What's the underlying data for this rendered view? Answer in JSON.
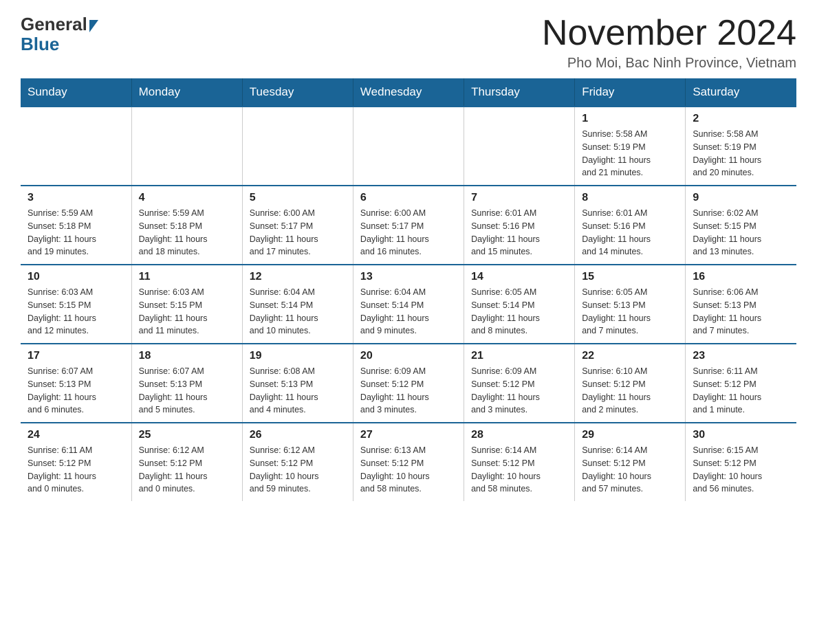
{
  "logo": {
    "general": "General",
    "blue": "Blue"
  },
  "title": "November 2024",
  "subtitle": "Pho Moi, Bac Ninh Province, Vietnam",
  "weekdays": [
    "Sunday",
    "Monday",
    "Tuesday",
    "Wednesday",
    "Thursday",
    "Friday",
    "Saturday"
  ],
  "rows": [
    [
      {
        "day": "",
        "info": ""
      },
      {
        "day": "",
        "info": ""
      },
      {
        "day": "",
        "info": ""
      },
      {
        "day": "",
        "info": ""
      },
      {
        "day": "",
        "info": ""
      },
      {
        "day": "1",
        "info": "Sunrise: 5:58 AM\nSunset: 5:19 PM\nDaylight: 11 hours\nand 21 minutes."
      },
      {
        "day": "2",
        "info": "Sunrise: 5:58 AM\nSunset: 5:19 PM\nDaylight: 11 hours\nand 20 minutes."
      }
    ],
    [
      {
        "day": "3",
        "info": "Sunrise: 5:59 AM\nSunset: 5:18 PM\nDaylight: 11 hours\nand 19 minutes."
      },
      {
        "day": "4",
        "info": "Sunrise: 5:59 AM\nSunset: 5:18 PM\nDaylight: 11 hours\nand 18 minutes."
      },
      {
        "day": "5",
        "info": "Sunrise: 6:00 AM\nSunset: 5:17 PM\nDaylight: 11 hours\nand 17 minutes."
      },
      {
        "day": "6",
        "info": "Sunrise: 6:00 AM\nSunset: 5:17 PM\nDaylight: 11 hours\nand 16 minutes."
      },
      {
        "day": "7",
        "info": "Sunrise: 6:01 AM\nSunset: 5:16 PM\nDaylight: 11 hours\nand 15 minutes."
      },
      {
        "day": "8",
        "info": "Sunrise: 6:01 AM\nSunset: 5:16 PM\nDaylight: 11 hours\nand 14 minutes."
      },
      {
        "day": "9",
        "info": "Sunrise: 6:02 AM\nSunset: 5:15 PM\nDaylight: 11 hours\nand 13 minutes."
      }
    ],
    [
      {
        "day": "10",
        "info": "Sunrise: 6:03 AM\nSunset: 5:15 PM\nDaylight: 11 hours\nand 12 minutes."
      },
      {
        "day": "11",
        "info": "Sunrise: 6:03 AM\nSunset: 5:15 PM\nDaylight: 11 hours\nand 11 minutes."
      },
      {
        "day": "12",
        "info": "Sunrise: 6:04 AM\nSunset: 5:14 PM\nDaylight: 11 hours\nand 10 minutes."
      },
      {
        "day": "13",
        "info": "Sunrise: 6:04 AM\nSunset: 5:14 PM\nDaylight: 11 hours\nand 9 minutes."
      },
      {
        "day": "14",
        "info": "Sunrise: 6:05 AM\nSunset: 5:14 PM\nDaylight: 11 hours\nand 8 minutes."
      },
      {
        "day": "15",
        "info": "Sunrise: 6:05 AM\nSunset: 5:13 PM\nDaylight: 11 hours\nand 7 minutes."
      },
      {
        "day": "16",
        "info": "Sunrise: 6:06 AM\nSunset: 5:13 PM\nDaylight: 11 hours\nand 7 minutes."
      }
    ],
    [
      {
        "day": "17",
        "info": "Sunrise: 6:07 AM\nSunset: 5:13 PM\nDaylight: 11 hours\nand 6 minutes."
      },
      {
        "day": "18",
        "info": "Sunrise: 6:07 AM\nSunset: 5:13 PM\nDaylight: 11 hours\nand 5 minutes."
      },
      {
        "day": "19",
        "info": "Sunrise: 6:08 AM\nSunset: 5:13 PM\nDaylight: 11 hours\nand 4 minutes."
      },
      {
        "day": "20",
        "info": "Sunrise: 6:09 AM\nSunset: 5:12 PM\nDaylight: 11 hours\nand 3 minutes."
      },
      {
        "day": "21",
        "info": "Sunrise: 6:09 AM\nSunset: 5:12 PM\nDaylight: 11 hours\nand 3 minutes."
      },
      {
        "day": "22",
        "info": "Sunrise: 6:10 AM\nSunset: 5:12 PM\nDaylight: 11 hours\nand 2 minutes."
      },
      {
        "day": "23",
        "info": "Sunrise: 6:11 AM\nSunset: 5:12 PM\nDaylight: 11 hours\nand 1 minute."
      }
    ],
    [
      {
        "day": "24",
        "info": "Sunrise: 6:11 AM\nSunset: 5:12 PM\nDaylight: 11 hours\nand 0 minutes."
      },
      {
        "day": "25",
        "info": "Sunrise: 6:12 AM\nSunset: 5:12 PM\nDaylight: 11 hours\nand 0 minutes."
      },
      {
        "day": "26",
        "info": "Sunrise: 6:12 AM\nSunset: 5:12 PM\nDaylight: 10 hours\nand 59 minutes."
      },
      {
        "day": "27",
        "info": "Sunrise: 6:13 AM\nSunset: 5:12 PM\nDaylight: 10 hours\nand 58 minutes."
      },
      {
        "day": "28",
        "info": "Sunrise: 6:14 AM\nSunset: 5:12 PM\nDaylight: 10 hours\nand 58 minutes."
      },
      {
        "day": "29",
        "info": "Sunrise: 6:14 AM\nSunset: 5:12 PM\nDaylight: 10 hours\nand 57 minutes."
      },
      {
        "day": "30",
        "info": "Sunrise: 6:15 AM\nSunset: 5:12 PM\nDaylight: 10 hours\nand 56 minutes."
      }
    ]
  ]
}
